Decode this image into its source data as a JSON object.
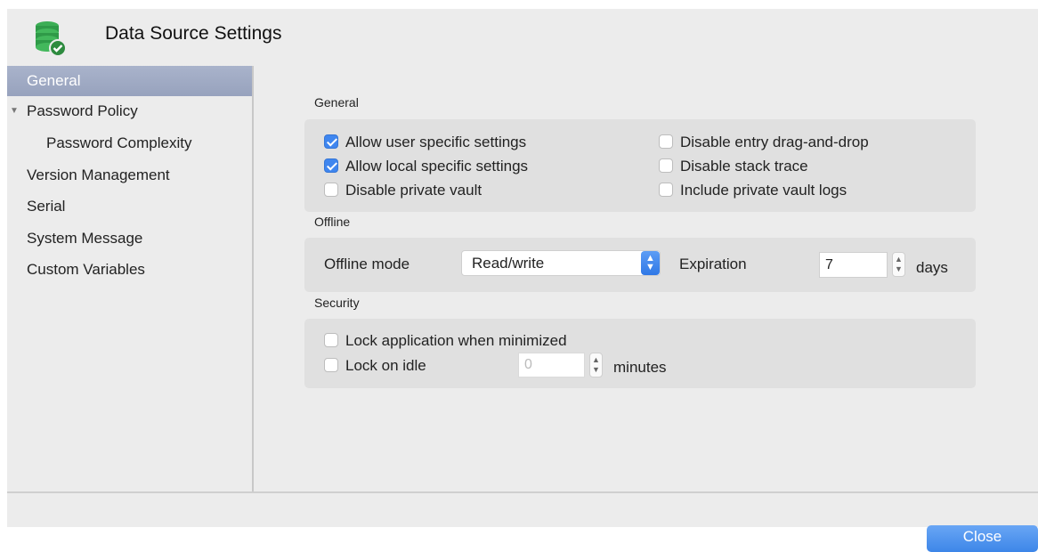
{
  "window": {
    "title": "Data Source Settings",
    "app_icon": "database-check-icon"
  },
  "sidebar": {
    "items": [
      {
        "label": "General",
        "selected": true
      },
      {
        "label": "Password Policy",
        "expanded": true
      },
      {
        "label": "Password Complexity"
      },
      {
        "label": "Version Management"
      },
      {
        "label": "Serial"
      },
      {
        "label": "System Message"
      },
      {
        "label": "Custom Variables"
      }
    ]
  },
  "general": {
    "section_label": "General",
    "options": [
      {
        "label": "Allow user specific settings",
        "checked": true
      },
      {
        "label": "Allow local specific settings",
        "checked": true
      },
      {
        "label": "Disable private vault",
        "checked": false
      },
      {
        "label": "Disable entry drag-and-drop",
        "checked": false
      },
      {
        "label": "Disable stack trace",
        "checked": false
      },
      {
        "label": "Include private vault logs",
        "checked": false
      }
    ]
  },
  "offline": {
    "section_label": "Offline",
    "mode_label": "Offline mode",
    "mode_value": "Read/write",
    "expiration_label": "Expiration",
    "expiration_value": "7",
    "expiration_unit": "days"
  },
  "security": {
    "section_label": "Security",
    "lock_minimized": {
      "label": "Lock application when minimized",
      "checked": false
    },
    "lock_idle": {
      "label": "Lock on idle",
      "checked": false
    },
    "idle_value": "0",
    "idle_unit": "minutes"
  },
  "footer": {
    "close_label": "Close"
  },
  "colors": {
    "accent": "#3f86ef",
    "selection": "#a9b3cb"
  }
}
